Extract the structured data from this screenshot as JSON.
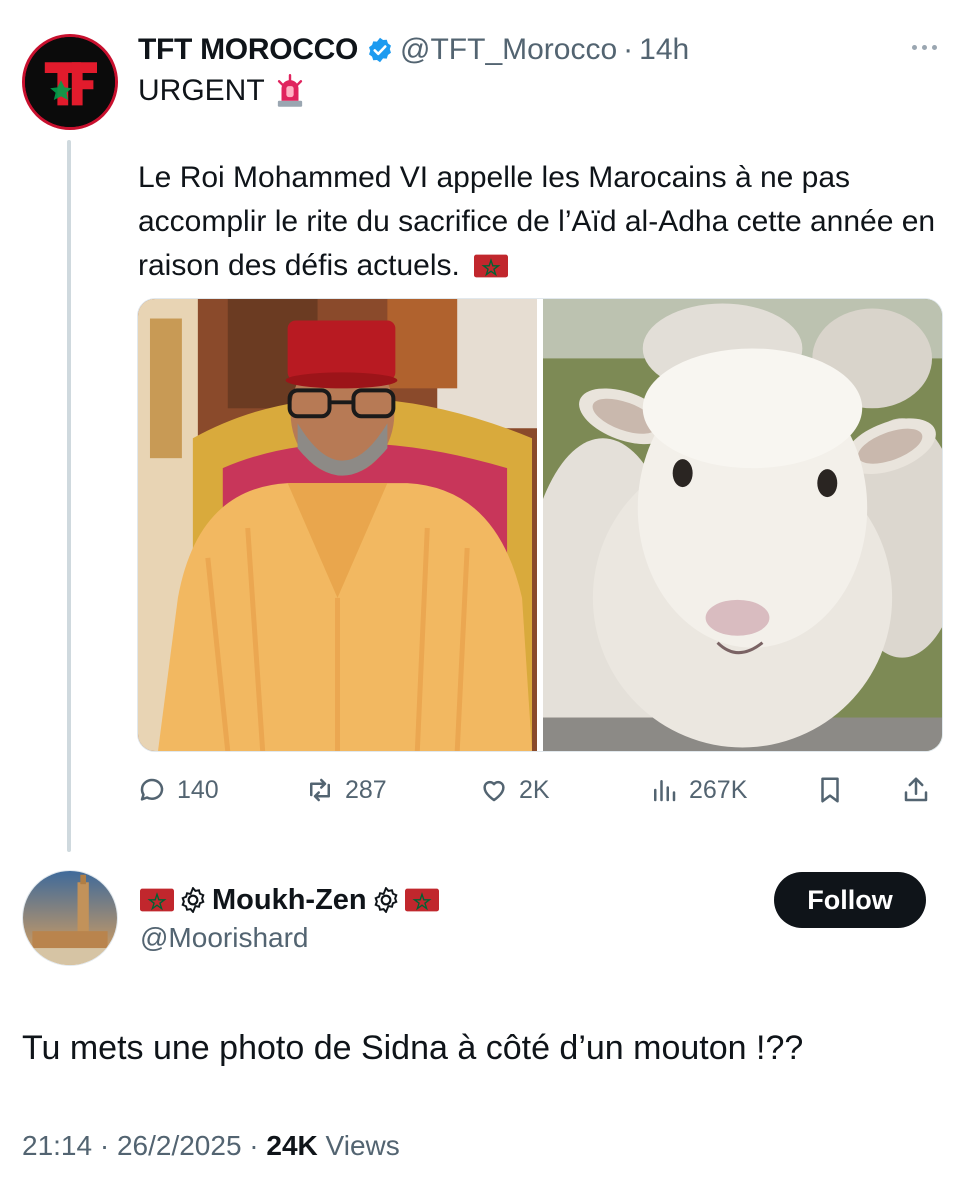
{
  "original_tweet": {
    "author_name": "TFT MOROCCO",
    "author_handle": "@TFT_Morocco",
    "separator": "·",
    "time_ago": "14h",
    "avatar_letter": "TF",
    "urgent_label": "URGENT",
    "body_text": "Le Roi Mohammed VI appelle les Marocains à ne pas accomplir le rite du sacrifice de l’Aïd al-Adha cette année en raison des défis actuels.",
    "icons": [
      "verified-badge-icon",
      "more-icon",
      "siren-icon",
      "morocco-flag-icon"
    ],
    "media": [
      {
        "name": "photo-king"
      },
      {
        "name": "photo-sheep"
      }
    ],
    "actions": {
      "replies": "140",
      "reposts": "287",
      "likes": "2K",
      "views": "267K"
    }
  },
  "reply_tweet": {
    "author_name": "Moukh-Zen",
    "author_handle": "@Moorishard",
    "follow_label": "Follow",
    "body_text": "Tu mets une photo de Sidna à côté d’un mouton !??",
    "timestamp": "21:14 · 26/2/2025 · ",
    "views_count": "24K",
    "views_label": " Views"
  },
  "colors": {
    "text_primary": "#0f1419",
    "text_secondary": "#536471",
    "verified_blue": "#1d9bf0",
    "follow_bg": "#0f1419",
    "flag_red": "#c1272d",
    "flag_green": "#006233"
  }
}
